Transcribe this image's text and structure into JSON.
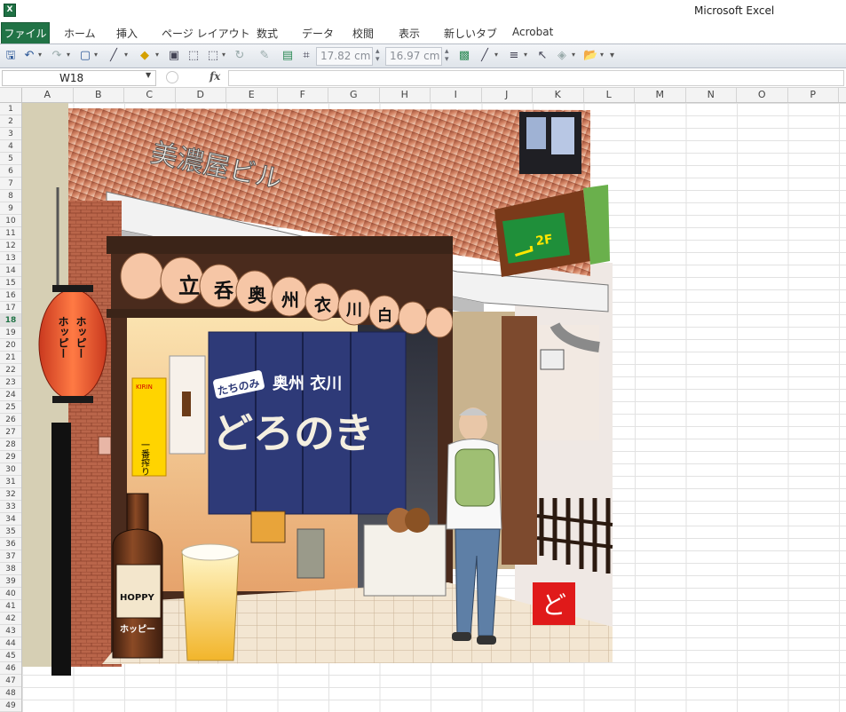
{
  "window": {
    "app_title": "Microsoft Excel",
    "app_icon_letter": "X"
  },
  "ribbon": {
    "tabs": [
      "ファイル",
      "ホーム",
      "挿入",
      "ページ レイアウト",
      "数式",
      "データ",
      "校閲",
      "表示",
      "新しいタブ",
      "Acrobat"
    ]
  },
  "toolbar": {
    "width_value": "17.82 cm",
    "height_value": "16.97 cm"
  },
  "formula_bar": {
    "name_box": "W18",
    "fx_label": "fx"
  },
  "grid": {
    "columns": [
      "A",
      "B",
      "C",
      "D",
      "E",
      "F",
      "G",
      "H",
      "I",
      "J",
      "K",
      "L",
      "M",
      "N",
      "O",
      "P"
    ],
    "rows": [
      "1",
      "2",
      "3",
      "4",
      "5",
      "6",
      "7",
      "8",
      "9",
      "10",
      "11",
      "12",
      "13",
      "14",
      "15",
      "16",
      "17",
      "18",
      "19",
      "20",
      "21",
      "22",
      "23",
      "24",
      "25",
      "26",
      "27",
      "28",
      "29",
      "30",
      "31",
      "32",
      "33",
      "34",
      "35",
      "36",
      "37",
      "38",
      "39",
      "40",
      "41",
      "42",
      "43",
      "44",
      "45",
      "46",
      "47",
      "48",
      "49"
    ],
    "selected_row": "18"
  },
  "artwork": {
    "building_sign": "美濃屋ビル",
    "lantern_row_chars": [
      "立",
      "呑",
      "奥",
      "州",
      "衣",
      "川",
      "白"
    ],
    "noren_tag": "たちのみ",
    "noren_sub": "奥州 衣川",
    "noren_main": "どろのき",
    "red_lantern_left": "ホッピー",
    "red_lantern_right": "ホッピー",
    "floor_sign": "2F",
    "poster_brand": "KIRIN",
    "poster_text": "一番搾り",
    "bottle_label_top": "HOPPY",
    "bottle_label_bottom": "ホッピー",
    "stamp_char": "ど"
  }
}
